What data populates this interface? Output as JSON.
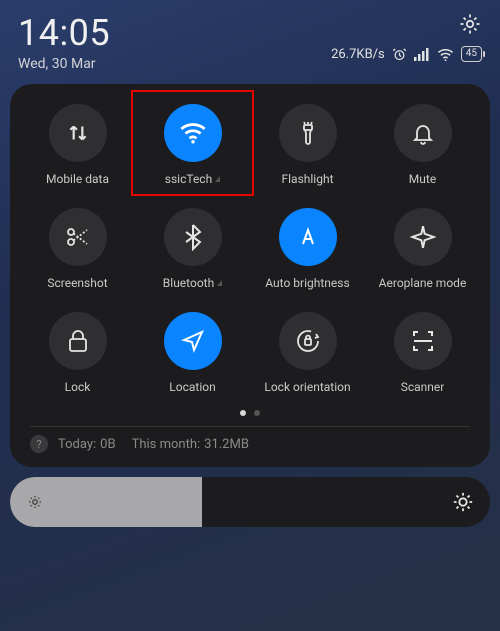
{
  "statusbar": {
    "time": "14:05",
    "date": "Wed, 30 Mar",
    "net_speed": "26.7KB/s",
    "battery_pct": "45"
  },
  "tiles": [
    {
      "label": "Mobile data",
      "active": false
    },
    {
      "label": "ssicTech",
      "active": true,
      "highlighted": true,
      "chevron": true
    },
    {
      "label": "Flashlight",
      "active": false
    },
    {
      "label": "Mute",
      "active": false
    },
    {
      "label": "Screenshot",
      "active": false
    },
    {
      "label": "Bluetooth",
      "active": false,
      "chevron": true
    },
    {
      "label": "Auto brightness",
      "active": true
    },
    {
      "label": "Aeroplane mode",
      "active": false
    },
    {
      "label": "Lock",
      "active": false
    },
    {
      "label": "Location",
      "active": true
    },
    {
      "label": "Lock orientation",
      "active": false
    },
    {
      "label": "Scanner",
      "active": false
    }
  ],
  "usage": {
    "today_label": "Today:",
    "today_value": "0B",
    "month_label": "This month:",
    "month_value": "31.2MB"
  },
  "colors": {
    "accent": "#0a84ff",
    "highlight": "#e10600"
  }
}
